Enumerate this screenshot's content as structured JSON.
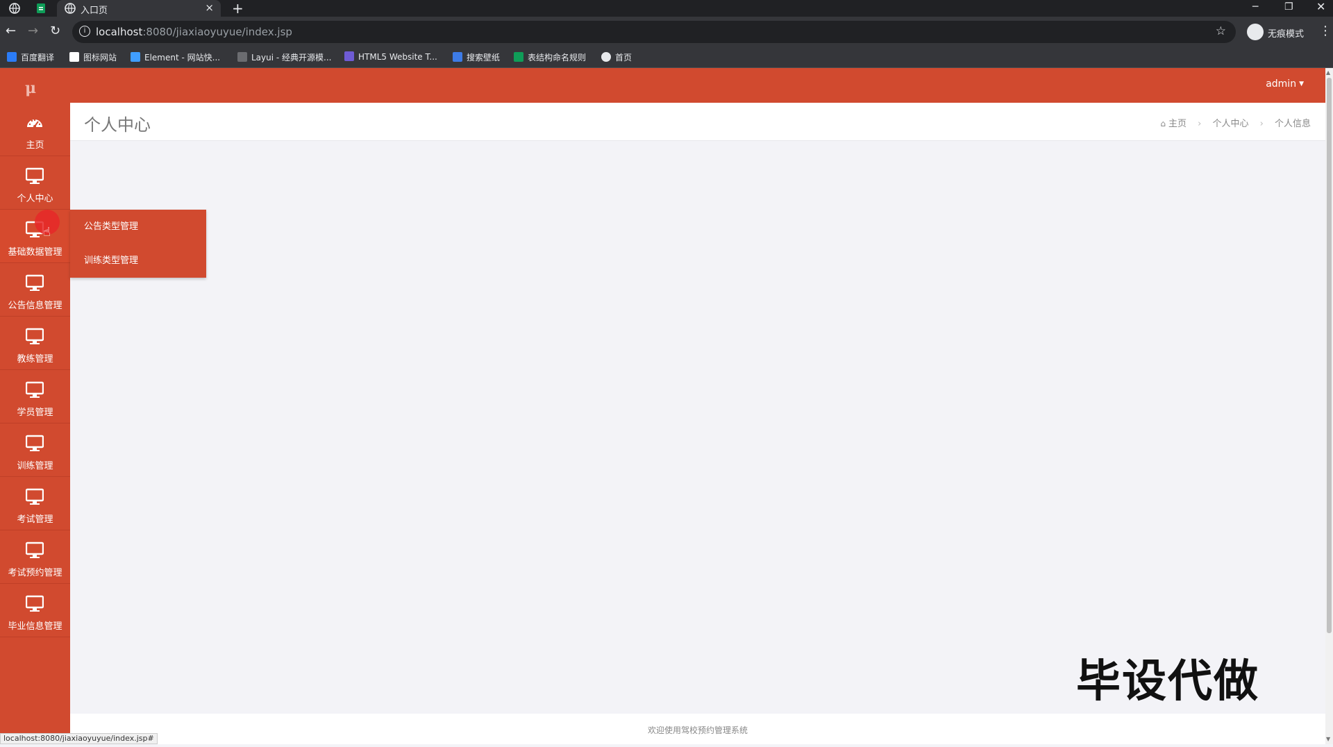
{
  "browser": {
    "tab_title": "入口页",
    "tab_close": "×",
    "new_tab": "+",
    "url_host": "localhost",
    "url_path": ":8080/jiaxiaoyuyue/index.jsp",
    "incognito_label": "无痕模式",
    "bookmarks": [
      {
        "label": "百度翻译",
        "color": "#2b7cf6"
      },
      {
        "label": "图标网站",
        "color": "#ffffff"
      },
      {
        "label": "Element - 网站快...",
        "color": "#409eff"
      },
      {
        "label": "Layui - 经典开源模...",
        "color": "#35363a"
      },
      {
        "label": "HTML5 Website T...",
        "color": "#6e5bd4"
      },
      {
        "label": "搜索壁纸",
        "color": "#3d7be6"
      },
      {
        "label": "表结构命名规则",
        "color": "#0f9d58"
      },
      {
        "label": "首页",
        "color": "#e8eaed"
      }
    ],
    "status_url": "localhost:8080/jiaxiaoyuyue/index.jsp#"
  },
  "app": {
    "accent_color": "#d14a2f",
    "logo": "μ",
    "user": "admin",
    "sidebar": [
      {
        "label": "主页",
        "icon": "dashboard-icon"
      },
      {
        "label": "个人中心",
        "icon": "monitor-icon"
      },
      {
        "label": "基础数据管理",
        "icon": "monitor-icon"
      },
      {
        "label": "公告信息管理",
        "icon": "monitor-icon"
      },
      {
        "label": "教练管理",
        "icon": "monitor-icon"
      },
      {
        "label": "学员管理",
        "icon": "monitor-icon"
      },
      {
        "label": "训练管理",
        "icon": "monitor-icon"
      },
      {
        "label": "考试管理",
        "icon": "monitor-icon"
      },
      {
        "label": "考试预约管理",
        "icon": "monitor-icon"
      },
      {
        "label": "毕业信息管理",
        "icon": "monitor-icon"
      }
    ],
    "submenu": [
      "公告类型管理",
      "训练类型管理"
    ],
    "page_title": "个人中心",
    "breadcrumb": [
      "主页",
      "个人中心",
      "个人信息"
    ],
    "footer": "欢迎使用驾校预约管理系统",
    "watermark": "毕设代做"
  }
}
